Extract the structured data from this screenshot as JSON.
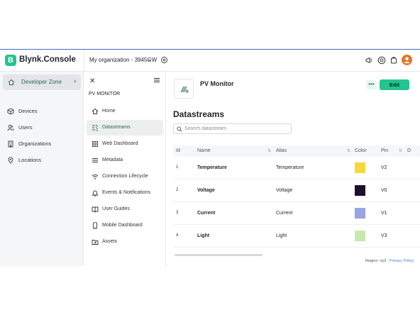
{
  "topbar": {
    "brand_letter": "B",
    "brand_name": "Blynk.Console",
    "org_name": "My organization - 3945GW",
    "icons": [
      "megaphone-icon",
      "help-icon",
      "notifications-icon",
      "avatar"
    ]
  },
  "sidebar": {
    "dev_zone": "Developer Zone",
    "items": [
      {
        "label": "Devices",
        "icon": "cube-icon"
      },
      {
        "label": "Users",
        "icon": "users-icon"
      },
      {
        "label": "Organizations",
        "icon": "building-icon"
      },
      {
        "label": "Locations",
        "icon": "pin-icon"
      }
    ]
  },
  "template_nav": {
    "title": "PV MONITOR",
    "items": [
      {
        "label": "Home",
        "icon": "home-icon"
      },
      {
        "label": "Datastreams",
        "icon": "datastreams-icon",
        "active": true
      },
      {
        "label": "Web Dashboard",
        "icon": "grid-icon"
      },
      {
        "label": "Metadata",
        "icon": "list-icon"
      },
      {
        "label": "Connection Lifecycle",
        "icon": "wifi-icon"
      },
      {
        "label": "Events & Notifications",
        "icon": "bell-icon"
      },
      {
        "label": "User Guides",
        "icon": "book-icon"
      },
      {
        "label": "Mobile Dashboard",
        "icon": "phone-icon"
      },
      {
        "label": "Assets",
        "icon": "folder-icon"
      }
    ]
  },
  "main": {
    "device_name": "PV Monitor",
    "more_label": "•••",
    "edit_label": "Edit",
    "section_title": "Datastreams",
    "search_placeholder": "Search datastream",
    "columns": [
      "Id",
      "Name",
      "Alias",
      "Color",
      "Pin",
      "D"
    ],
    "rows": [
      {
        "id": "1",
        "name": "Temperature",
        "alias": "Temperature",
        "color": "#f5d93b",
        "pin": "V2"
      },
      {
        "id": "2",
        "name": "Voltage",
        "alias": "Voltage",
        "color": "#1e0f2e",
        "pin": "V0"
      },
      {
        "id": "3",
        "name": "Current",
        "alias": "Current",
        "color": "#9aa3e6",
        "pin": "V1"
      },
      {
        "id": "4",
        "name": "Light",
        "alias": "Light",
        "color": "#c7e9b0",
        "pin": "V3"
      }
    ],
    "region": "Region: ny3",
    "privacy": "Privacy Policy"
  },
  "colors": {
    "accent": "#23c48e",
    "active_text": "#2d6a4f",
    "avatar": "#e2762a"
  }
}
